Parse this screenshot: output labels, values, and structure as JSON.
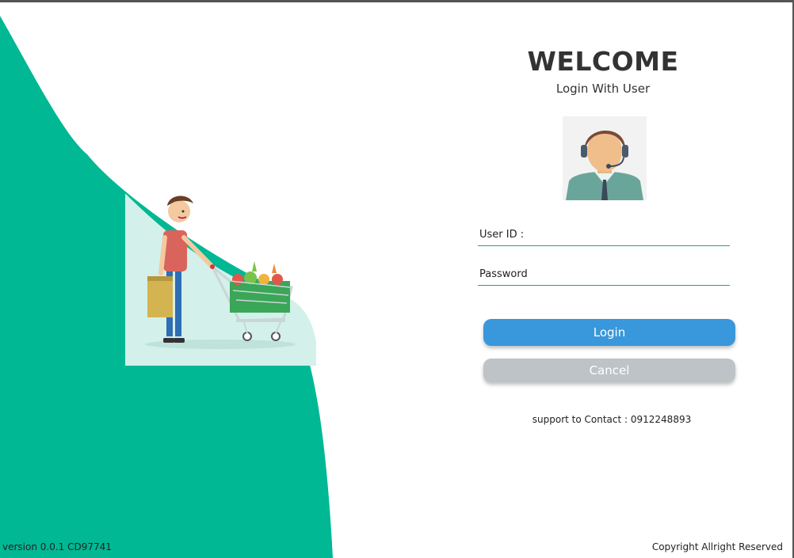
{
  "header": {
    "title": "WELCOME",
    "subtitle": "Login With User"
  },
  "form": {
    "user_id_label": "User ID :",
    "user_id_value": "",
    "password_label": "Password",
    "password_value": ""
  },
  "buttons": {
    "login": "Login",
    "cancel": "Cancel"
  },
  "support": "support to Contact : 0912248893",
  "footer": {
    "version": "version 0.0.1 CD97741",
    "copyright": "Copyright Allright Reserved"
  },
  "colors": {
    "accent": "#00b894",
    "login_button": "#3997db",
    "cancel_button": "#bdc3c7",
    "field_underline": "#1aa687"
  },
  "icons": {
    "avatar": "support-agent-avatar",
    "illustration": "shopper-with-cart"
  }
}
